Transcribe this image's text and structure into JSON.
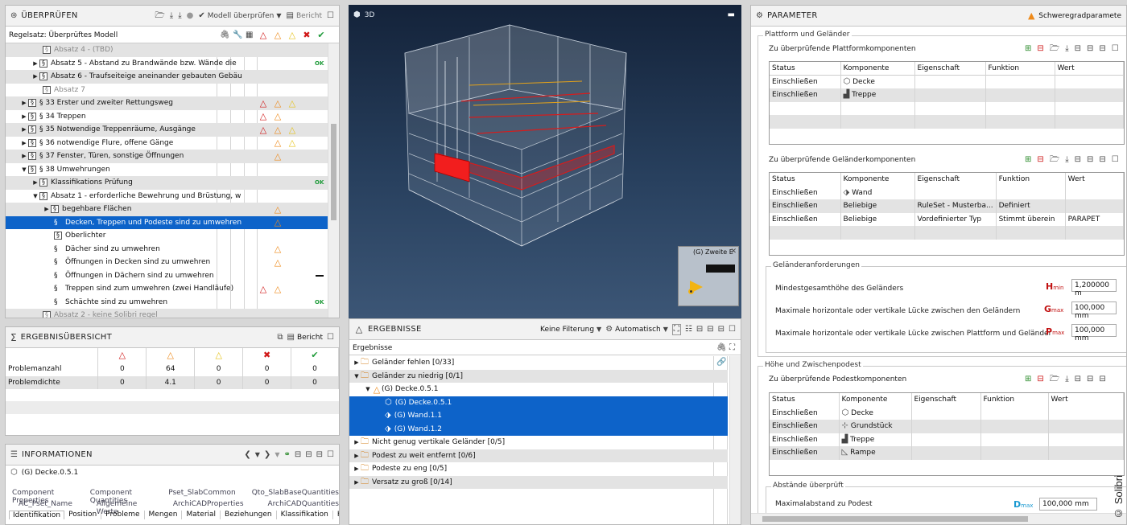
{
  "check": {
    "title": "ÜBERPRÜFEN",
    "toolbar_model": "Modell überprüfen",
    "toolbar_report": "Bericht",
    "ruleset_label": "Regelsatz: Überprüftes Modell",
    "rows": [
      {
        "text": "Absatz 4 - (TBD)"
      },
      {
        "text": "Absatz 5 - Abstand zu Brandwände bzw. Wände die",
        "ok": "OK"
      },
      {
        "text": "Absatz 6 - Traufseiteige aneinander gebauten Gebäu"
      },
      {
        "text": "Absatz 7"
      },
      {
        "text": "§ 33 Erster und zweiter Rettungsweg"
      },
      {
        "text": "§ 34 Treppen"
      },
      {
        "text": "§ 35 Notwendige Treppenräume, Ausgänge"
      },
      {
        "text": "§ 36 notwendige Flure, offene Gänge"
      },
      {
        "text": "§ 37 Fenster, Türen, sonstige Öffnungen"
      },
      {
        "text": "§ 38 Umwehrungen"
      },
      {
        "text": "Klassifikations Prüfung",
        "ok": "OK"
      },
      {
        "text": "Absatz 1 - erforderliche Bewehrung und Brüstung, w"
      },
      {
        "text": "begehbare Flächen"
      },
      {
        "text": "Decken, Treppen und Podeste sind zu umwehren"
      },
      {
        "text": "Oberlichter"
      },
      {
        "text": "Dächer  sind zu umwehren"
      },
      {
        "text": "Öffnungen in Decken sind zu umwehren"
      },
      {
        "text": "Öffnungen in Dächern sind zu umwehren"
      },
      {
        "text": "Treppen sind zum umwehren (zwei Handläufe)"
      },
      {
        "text": "Schächte  sind zu umwehren",
        "ok": "OK"
      },
      {
        "text": "Absatz 2 - keine Solibri regel"
      }
    ]
  },
  "summary": {
    "title": "ERGEBNISÜBERSICHT",
    "report": "Bericht",
    "rows": [
      {
        "label": "Problemanzahl",
        "values": [
          "0",
          "64",
          "0",
          "0",
          "0"
        ]
      },
      {
        "label": "Problemdichte",
        "values": [
          "0",
          "4.1",
          "0",
          "0",
          "0"
        ]
      }
    ]
  },
  "info": {
    "title": "INFORMATIONEN",
    "selected": "(G) Decke.0.5.1",
    "tabs_row1": [
      "Component Properties",
      "Component Quantities",
      "Pset_SlabCommon",
      "Qto_SlabBaseQuantities"
    ],
    "tabs_row2": [
      "AC_Pset_Name",
      "Allgemeine Werte",
      "ArchiCADProperties",
      "ArchiCADQuantities"
    ],
    "tabs_row3": [
      "Identifikation",
      "Position",
      "Probleme",
      "Mengen",
      "Material",
      "Beziehungen",
      "Klassifikation",
      "Hyperlinks"
    ]
  },
  "view3d": {
    "title": "3D",
    "minimap_label": "(G) Zweite E"
  },
  "results": {
    "title": "ERGEBNISSE",
    "filter": "Keine Filterung",
    "auto": "Automatisch",
    "header": "Ergebnisse",
    "rows": [
      {
        "text": "Geländer fehlen [0/33]"
      },
      {
        "text": "Geländer zu niedrig [0/1]"
      },
      {
        "text": "(G) Decke.0.5.1"
      },
      {
        "text": "(G) Decke.0.5.1"
      },
      {
        "text": "(G) Wand.1.1"
      },
      {
        "text": "(G) Wand.1.2"
      },
      {
        "text": "Nicht genug vertikale Geländer [0/5]"
      },
      {
        "text": "Podest zu weit entfernt [0/6]"
      },
      {
        "text": "Podeste zu eng [0/5]"
      },
      {
        "text": "Versatz zu groß [0/14]"
      }
    ]
  },
  "params": {
    "title": "PARAMETER",
    "tab": "Schweregradparamete",
    "group1": "Plattform und Geländer",
    "sub1": "Zu überprüfende Plattformkomponenten",
    "sub2": "Zu überprüfende Geländerkomponenten",
    "req_group": "Geländeranforderungen",
    "group2": "Höhe und Zwischenpodest",
    "sub3": "Zu überprüfende Podestkomponenten",
    "dist_group": "Abstände überprüft",
    "cols": [
      "Status",
      "Komponente",
      "Eigenschaft",
      "Funktion",
      "Wert"
    ],
    "platform_rows": [
      [
        "Einschließen",
        "Decke",
        "",
        "",
        ""
      ],
      [
        "Einschließen",
        "Treppe",
        "",
        "",
        ""
      ]
    ],
    "railing_rows": [
      [
        "Einschließen",
        "Wand",
        "",
        "",
        ""
      ],
      [
        "Einschließen",
        "Beliebige",
        "RuleSet - Musterba...",
        "Definiert",
        ""
      ],
      [
        "Einschließen",
        "Beliebige",
        "Vordefinierter Typ",
        "Stimmt überein",
        "PARAPET"
      ]
    ],
    "landing_rows": [
      [
        "Einschließen",
        "Decke",
        "",
        "",
        ""
      ],
      [
        "Einschließen",
        "Grundstück",
        "",
        "",
        ""
      ],
      [
        "Einschließen",
        "Treppe",
        "",
        "",
        ""
      ],
      [
        "Einschließen",
        "Rampe",
        "",
        "",
        ""
      ]
    ],
    "req": [
      {
        "label": "Mindestgesamthöhe des Geländers",
        "sym": "H",
        "sub": "min",
        "value": "1,200000 m"
      },
      {
        "label": "Maximale horizontale oder vertikale Lücke zwischen den Geländern",
        "sym": "G",
        "sub": "max",
        "value": "100,000 mm"
      },
      {
        "label": "Maximale horizontale oder vertikale Lücke zwischen Plattform und Geländer",
        "sym": "P",
        "sub": "max",
        "value": "100,000 mm"
      }
    ],
    "dist": {
      "label": "Maximalabstand zu Podest",
      "sym": "D",
      "sub": "max",
      "value": "100,000 mm"
    }
  },
  "watermark": "© Solibri"
}
